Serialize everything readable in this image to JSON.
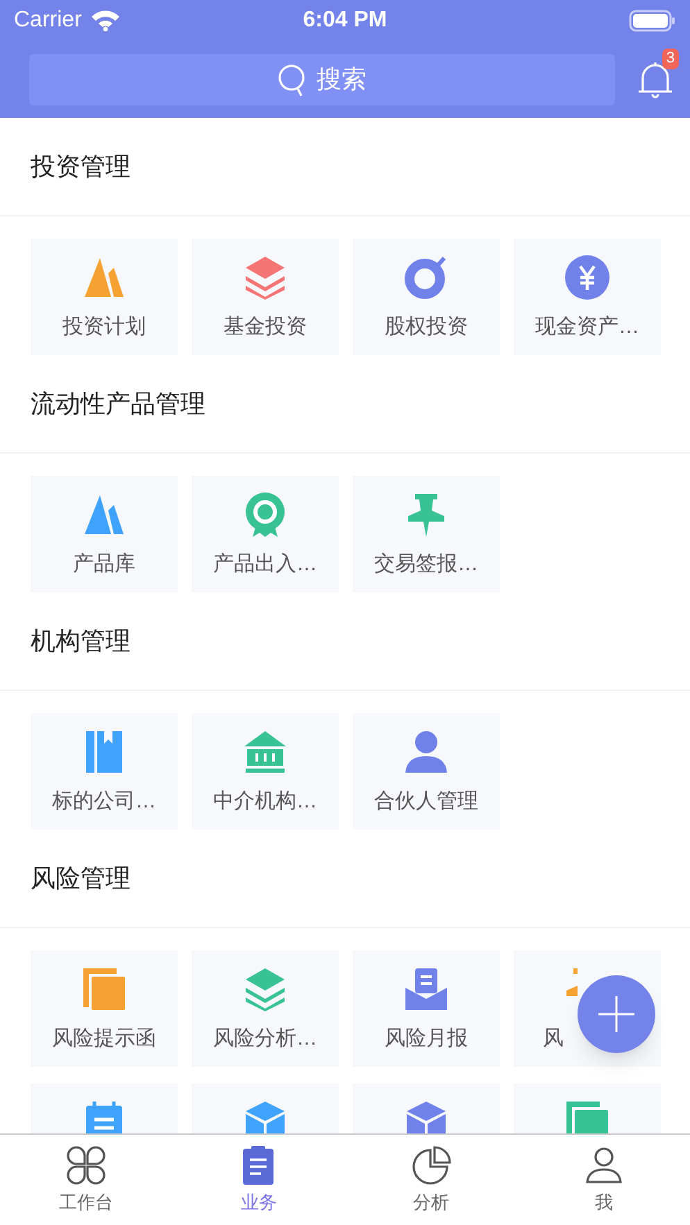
{
  "status_bar": {
    "carrier": "Carrier",
    "time": "6:04 PM"
  },
  "header": {
    "search": {
      "placeholder": "搜索"
    },
    "notifications": {
      "badge": "3"
    }
  },
  "sections": [
    {
      "title": "投资管理",
      "items": [
        {
          "label": "投资计划",
          "kind": "peaks",
          "color": "#f5a232"
        },
        {
          "label": "基金投资",
          "kind": "layers",
          "color": "#f57474"
        },
        {
          "label": "股权投资",
          "kind": "target",
          "color": "#7082ea"
        },
        {
          "label": "现金资产…",
          "kind": "yen",
          "color": "#7082ea"
        }
      ]
    },
    {
      "title": "流动性产品管理",
      "items": [
        {
          "label": "产品库",
          "kind": "peaks",
          "color": "#3fa3fb"
        },
        {
          "label": "产品出入…",
          "kind": "badge",
          "color": "#39c394"
        },
        {
          "label": "交易签报…",
          "kind": "pin",
          "color": "#39c394"
        }
      ]
    },
    {
      "title": "机构管理",
      "items": [
        {
          "label": "标的公司…",
          "kind": "book",
          "color": "#3fa3fb"
        },
        {
          "label": "中介机构…",
          "kind": "bank",
          "color": "#39c394"
        },
        {
          "label": "合伙人管理",
          "kind": "person",
          "color": "#7082ea"
        }
      ]
    },
    {
      "title": "风险管理",
      "items": [
        {
          "label": "风险提示函",
          "kind": "copy",
          "color": "#f5a232"
        },
        {
          "label": "风险分析…",
          "kind": "layers",
          "color": "#39c394"
        },
        {
          "label": "风险月报",
          "kind": "inbox",
          "color": "#7082ea"
        },
        {
          "label": "风",
          "kind": "pin",
          "color": "#f5a232",
          "covered": true
        },
        {
          "kind": "notepad",
          "color": "#3fa3fb"
        },
        {
          "kind": "cube",
          "color": "#3fa3fb"
        },
        {
          "kind": "cube",
          "color": "#7082ea"
        },
        {
          "kind": "copy",
          "color": "#39c394"
        }
      ]
    }
  ],
  "tab_bar": [
    {
      "label": "工作台",
      "kind": "clover",
      "selected": false
    },
    {
      "label": "业务",
      "kind": "clipboard",
      "selected": true
    },
    {
      "label": "分析",
      "kind": "pie",
      "selected": false
    },
    {
      "label": "我",
      "kind": "user",
      "selected": false
    }
  ]
}
